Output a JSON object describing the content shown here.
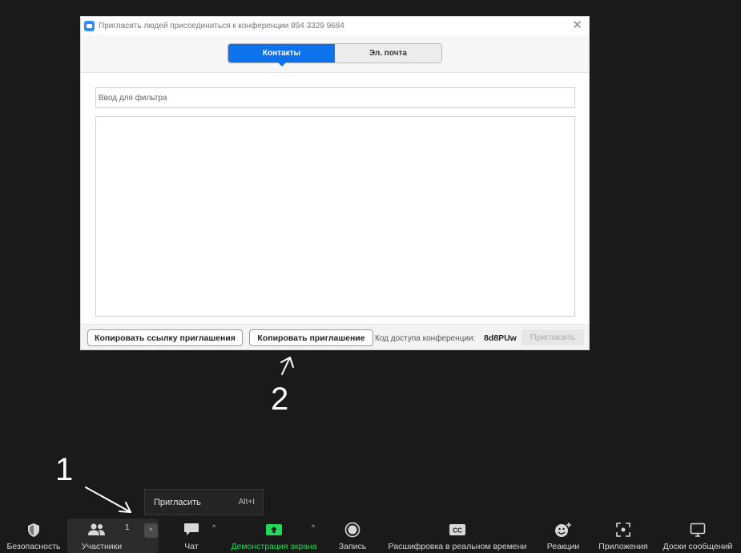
{
  "dialog": {
    "title": "Пригласить людей присоединиться к конференции 894 3329 9684",
    "close_glyph": "✕",
    "tabs": [
      {
        "label": "Контакты",
        "active": true
      },
      {
        "label": "Эл. почта",
        "active": false
      }
    ],
    "filter_placeholder": "Ввод для фильтра",
    "copy_link_label": "Копировать ссылку приглашения",
    "copy_invite_label": "Копировать приглашение",
    "access_code_label": "Код доступа конференции:",
    "access_code_value": "8d8PUw",
    "invite_label": "Пригласить"
  },
  "annotations": {
    "one": "1",
    "two": "2"
  },
  "popup": {
    "label": "Пригласить",
    "shortcut": "Alt+I"
  },
  "toolbar": {
    "items": [
      {
        "label": "Безопасность",
        "icon": "shield-icon"
      },
      {
        "label": "Участники",
        "icon": "participants-icon",
        "badge": "1"
      },
      {
        "label": "Чат",
        "icon": "chat-icon"
      },
      {
        "label": "Демонстрация экрана",
        "icon": "share-screen-icon"
      },
      {
        "label": "Запись",
        "icon": "record-icon"
      },
      {
        "label": "Расшифровка в реальном времени",
        "icon": "cc-icon"
      },
      {
        "label": "Реакции",
        "icon": "reactions-icon"
      },
      {
        "label": "Приложения",
        "icon": "apps-icon"
      },
      {
        "label": "Доски сообщений",
        "icon": "whiteboard-icon"
      }
    ],
    "chevron_glyph": "^"
  },
  "colors": {
    "accent": "#0e72ed",
    "share_green": "#23d959",
    "background": "#1a1a1a"
  }
}
